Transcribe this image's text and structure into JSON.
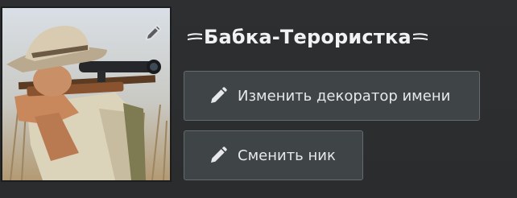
{
  "profile": {
    "username": "Бабка-Терористка",
    "avatar_icon": "sniper-avatar-image",
    "edit_avatar_icon": "pencil-icon",
    "name_decoration_icon": "wing-decoration-icon"
  },
  "actions": {
    "change_decorator_label": "Изменить декоратор имени",
    "change_nick_label": "Сменить ник",
    "button_icon": "pencil-icon"
  },
  "colors": {
    "background": "#2b2d2f",
    "button_bg": "#3f4447",
    "button_border": "#656a6e",
    "text": "#e9ebec"
  }
}
